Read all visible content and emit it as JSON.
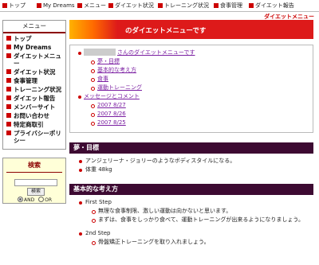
{
  "topnav": [
    "トップ",
    "My Dreams",
    "メニュー",
    "ダイエット状況",
    "トレーニング状況",
    "食事管理",
    "ダイエット報告"
  ],
  "site_title": "ダイエットメニュー",
  "sidebar": {
    "menu_title": "メニュー",
    "items": [
      "トップ",
      "My Dreams",
      "ダイエットメニュー",
      "ダイエット状況",
      "食事管理",
      "トレーニング状況",
      "ダイエット報告",
      "メンバーサイト",
      "お問い合わせ",
      "特定商取引",
      "プライバシーポリシー"
    ]
  },
  "search": {
    "title": "検索",
    "button": "検索",
    "and_label": "AND",
    "or_label": "OR"
  },
  "main": {
    "hero_text": "のダイエットメニューです",
    "toc": {
      "top_link": "さんのダイエットメニューです",
      "sub_links": [
        "夢・目標",
        "基本的な考え方",
        "食事",
        "運動トレーニング"
      ],
      "message_link": "メッセージとコメント",
      "dates": [
        "2007 8/27",
        "2007 8/26",
        "2007 8/25"
      ]
    },
    "goals": {
      "heading": "夢・目標",
      "items": [
        "アンジェリーナ・ジョリーのようなボディスタイルになる。",
        "体重 48kg"
      ]
    },
    "approach": {
      "heading": "基本的な考え方",
      "step1": "First Step",
      "step1_items": [
        "無理な食事制限、激しい運動は向かないと思います。",
        "まずは、食事をしっかり食べて、運動トレーニングが出来るようになりましょう。"
      ],
      "step2": "2nd Step",
      "step2_items": [
        "骨盤矯正トレーニングを取り入れましょう。"
      ]
    }
  }
}
